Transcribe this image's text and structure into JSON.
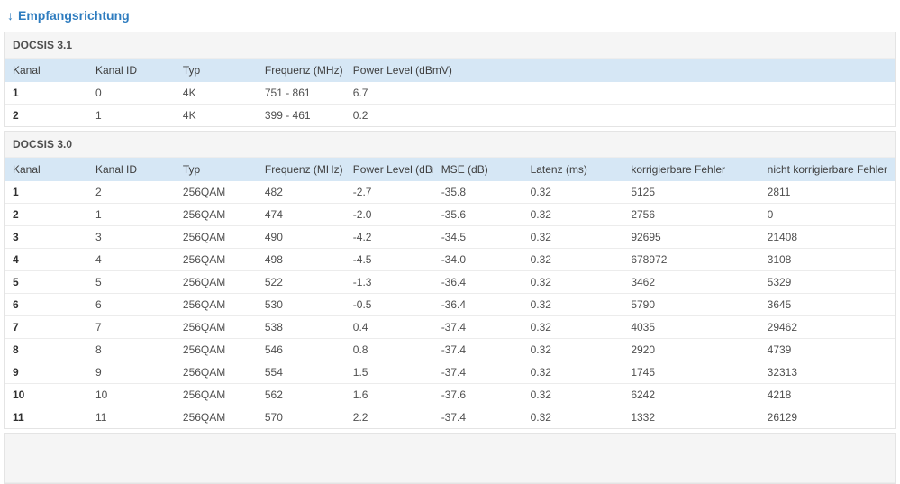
{
  "page": {
    "title_arrow": "↓",
    "title": "Empfangsrichtung"
  },
  "colors": {
    "accent_blue": "#2e7cbf",
    "table_header_bg": "#d6e7f5",
    "section_header_bg": "#f5f5f5",
    "panel_border": "#e4e4e4"
  },
  "docsis31": {
    "section_title": "DOCSIS 3.1",
    "columns": [
      "Kanal",
      "Kanal ID",
      "Typ",
      "Frequenz (MHz)",
      "Power Level (dBmV)"
    ],
    "rows": [
      [
        "1",
        "0",
        "4K",
        "751 - 861",
        "6.7"
      ],
      [
        "2",
        "1",
        "4K",
        "399 - 461",
        "0.2"
      ]
    ]
  },
  "docsis30": {
    "section_title": "DOCSIS 3.0",
    "columns": [
      "Kanal",
      "Kanal ID",
      "Typ",
      "Frequenz (MHz)",
      "Power Level (dBmV)",
      "MSE (dB)",
      "Latenz (ms)",
      "korrigierbare Fehler",
      "nicht korrigierbare Fehler"
    ],
    "rows": [
      [
        "1",
        "2",
        "256QAM",
        "482",
        "-2.7",
        "-35.8",
        "0.32",
        "5125",
        "2811"
      ],
      [
        "2",
        "1",
        "256QAM",
        "474",
        "-2.0",
        "-35.6",
        "0.32",
        "2756",
        "0"
      ],
      [
        "3",
        "3",
        "256QAM",
        "490",
        "-4.2",
        "-34.5",
        "0.32",
        "92695",
        "21408"
      ],
      [
        "4",
        "4",
        "256QAM",
        "498",
        "-4.5",
        "-34.0",
        "0.32",
        "678972",
        "3108"
      ],
      [
        "5",
        "5",
        "256QAM",
        "522",
        "-1.3",
        "-36.4",
        "0.32",
        "3462",
        "5329"
      ],
      [
        "6",
        "6",
        "256QAM",
        "530",
        "-0.5",
        "-36.4",
        "0.32",
        "5790",
        "3645"
      ],
      [
        "7",
        "7",
        "256QAM",
        "538",
        "0.4",
        "-37.4",
        "0.32",
        "4035",
        "29462"
      ],
      [
        "8",
        "8",
        "256QAM",
        "546",
        "0.8",
        "-37.4",
        "0.32",
        "2920",
        "4739"
      ],
      [
        "9",
        "9",
        "256QAM",
        "554",
        "1.5",
        "-37.4",
        "0.32",
        "1745",
        "32313"
      ],
      [
        "10",
        "10",
        "256QAM",
        "562",
        "1.6",
        "-37.6",
        "0.32",
        "6242",
        "4218"
      ],
      [
        "11",
        "11",
        "256QAM",
        "570",
        "2.2",
        "-37.4",
        "0.32",
        "1332",
        "26129"
      ]
    ]
  }
}
